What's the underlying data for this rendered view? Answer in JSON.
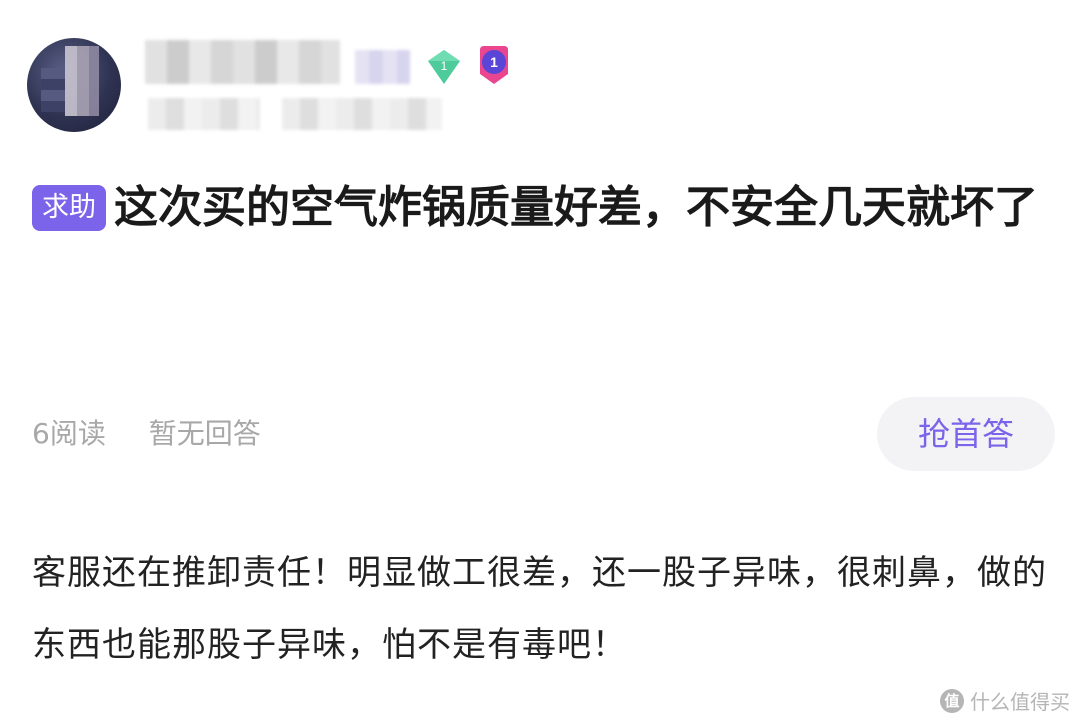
{
  "user": {
    "level_badge": "1",
    "medal_badge": "1",
    "level_icon": "diamond-level-icon",
    "medal_icon": "medal-badge-icon"
  },
  "post": {
    "tag": "求助",
    "title": "这次买的空气炸锅质量好差，不安全几天就坏了",
    "reads": "6阅读",
    "answers": "暂无回答",
    "answer_button": "抢首答",
    "body": "客服还在推卸责任！明显做工很差，还一股子异味，很刺鼻，做的东西也能那股子异味，怕不是有毒吧！"
  },
  "watermark": {
    "logo": "值",
    "text": "什么值得买"
  },
  "colors": {
    "accent": "#7b63ea",
    "level_green": "#4ecb9b",
    "muted_text": "#a8a8a8",
    "button_bg": "#f3f3f6"
  }
}
